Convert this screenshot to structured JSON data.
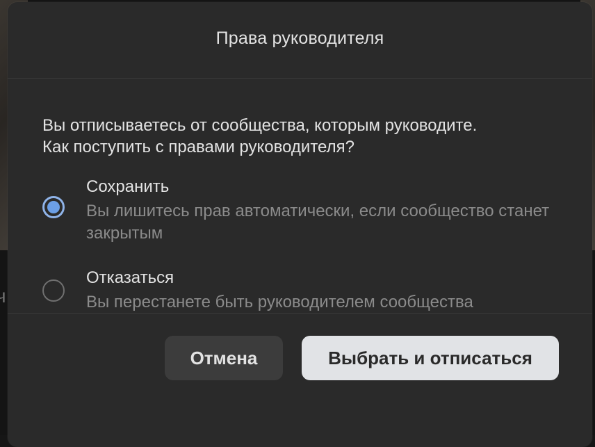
{
  "dialog": {
    "title": "Права руководителя",
    "question_line1": "Вы отписываетесь от сообщества, которым руководите.",
    "question_line2": "Как поступить с правами руководителя?",
    "options": [
      {
        "title": "Сохранить",
        "description": "Вы лишитесь прав автоматически, если сообщество станет закрытым",
        "selected": true
      },
      {
        "title": "Отказаться",
        "description": "Вы перестанете быть руководителем сообщества",
        "selected": false
      }
    ],
    "cancel_label": "Отмена",
    "confirm_label": "Выбрать и отписаться"
  },
  "colors": {
    "dialog_bg": "#2a2a2a",
    "radio_accent": "#6c9fe6",
    "confirm_bg": "#e1e3e6"
  }
}
